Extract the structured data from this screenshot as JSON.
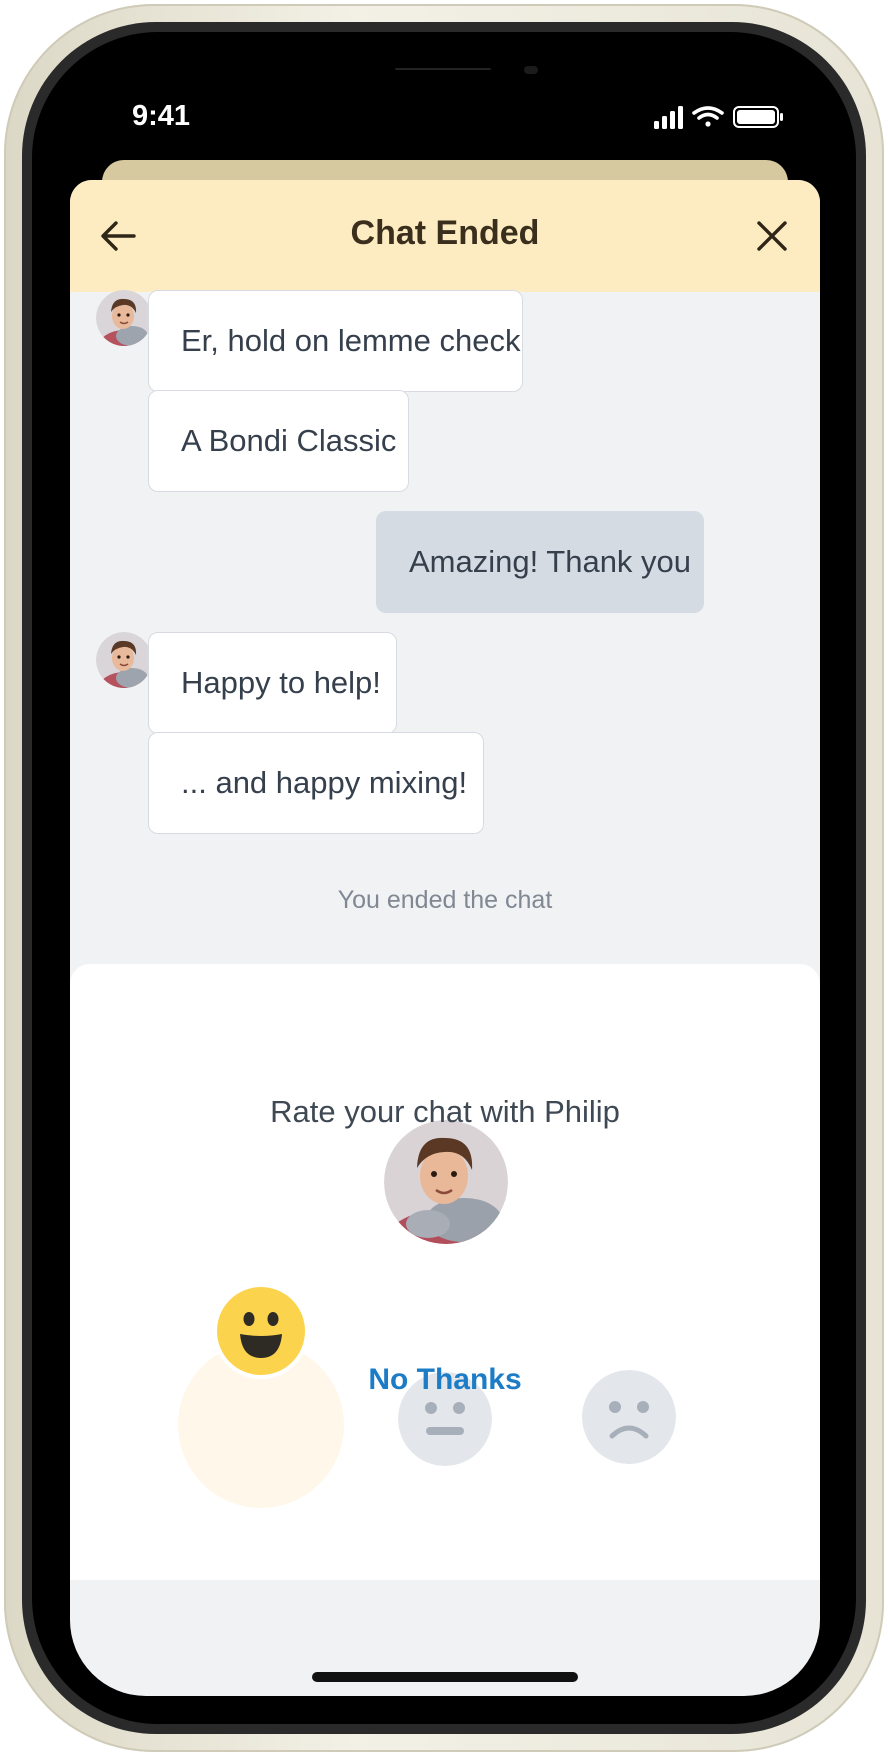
{
  "status_bar": {
    "time": "9:41"
  },
  "header": {
    "title": "Chat Ended"
  },
  "messages": [
    {
      "sender": "agent",
      "text": "Er, hold on lemme check"
    },
    {
      "sender": "agent",
      "text": "A Bondi Classic"
    },
    {
      "sender": "user",
      "text": "Amazing! Thank you"
    },
    {
      "sender": "agent",
      "text": "Happy to help!"
    },
    {
      "sender": "agent",
      "text": "... and happy mixing!"
    }
  ],
  "system_note": "You ended the chat",
  "rating": {
    "prompt": "Rate your chat with Philip",
    "options": [
      "happy",
      "neutral",
      "sad"
    ],
    "selected": "happy",
    "dismiss_label": "No Thanks"
  },
  "colors": {
    "header_bg": "#fdebc2",
    "chat_bg": "#f1f2f4",
    "accent_link": "#1d7cc6",
    "happy_face": "#fcd34d"
  }
}
